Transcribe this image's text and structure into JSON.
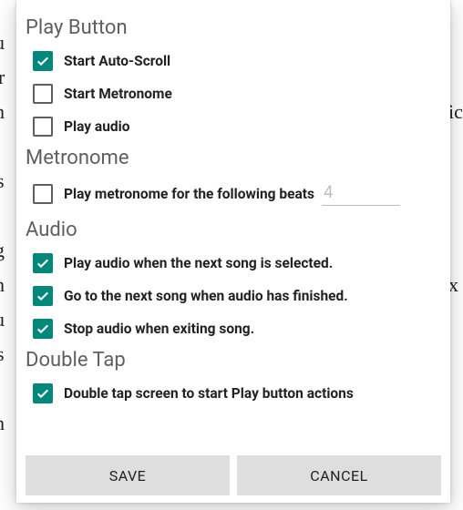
{
  "play_button": {
    "title": "Play Button",
    "options": [
      {
        "label": "Start Auto-Scroll",
        "checked": true
      },
      {
        "label": "Start Metronome",
        "checked": false
      },
      {
        "label": "Play audio",
        "checked": false
      }
    ]
  },
  "metronome": {
    "title": "Metronome",
    "beats_label": "Play metronome for the following beats",
    "beats_checked": false,
    "beats_placeholder": "4",
    "beats_value": ""
  },
  "audio": {
    "title": "Audio",
    "options": [
      {
        "label": "Play audio when the next song is selected.",
        "checked": true
      },
      {
        "label": "Go to the next song when audio has finished.",
        "checked": true
      },
      {
        "label": "Stop audio when exiting song.",
        "checked": true
      }
    ]
  },
  "double_tap": {
    "title": "Double Tap",
    "option": {
      "label": "Double tap screen to start Play button actions",
      "checked": true
    }
  },
  "buttons": {
    "save": "SAVE",
    "cancel": "CANCEL"
  },
  "colors": {
    "accent": "#00897b"
  }
}
